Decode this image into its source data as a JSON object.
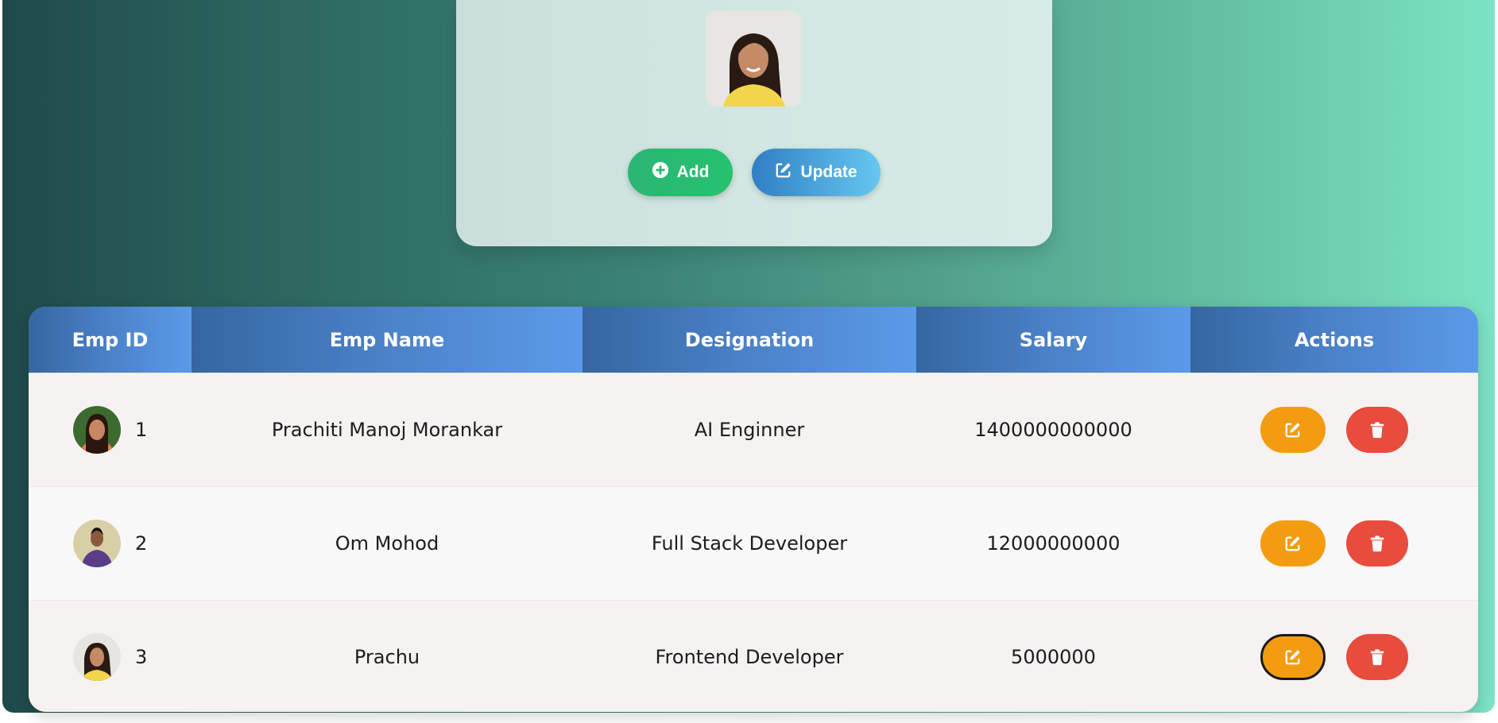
{
  "form": {
    "add_label": "Add",
    "update_label": "Update"
  },
  "table": {
    "headers": [
      "Emp ID",
      "Emp Name",
      "Designation",
      "Salary",
      "Actions"
    ],
    "rows": [
      {
        "id": "1",
        "name": "Prachiti Manoj Morankar",
        "designation": "AI Enginner",
        "salary": "1400000000000"
      },
      {
        "id": "2",
        "name": "Om Mohod",
        "designation": "Full Stack Developer",
        "salary": "12000000000"
      },
      {
        "id": "3",
        "name": "Prachu",
        "designation": "Frontend Developer",
        "salary": "5000000"
      }
    ]
  },
  "colors": {
    "add": "#2bb673",
    "update": "#3a8fd0",
    "edit": "#f39c12",
    "delete": "#e74c3c"
  },
  "icons": {
    "add": "plus-circle-icon",
    "update": "pen-square-icon",
    "edit": "pen-square-icon",
    "delete": "trash-icon"
  }
}
